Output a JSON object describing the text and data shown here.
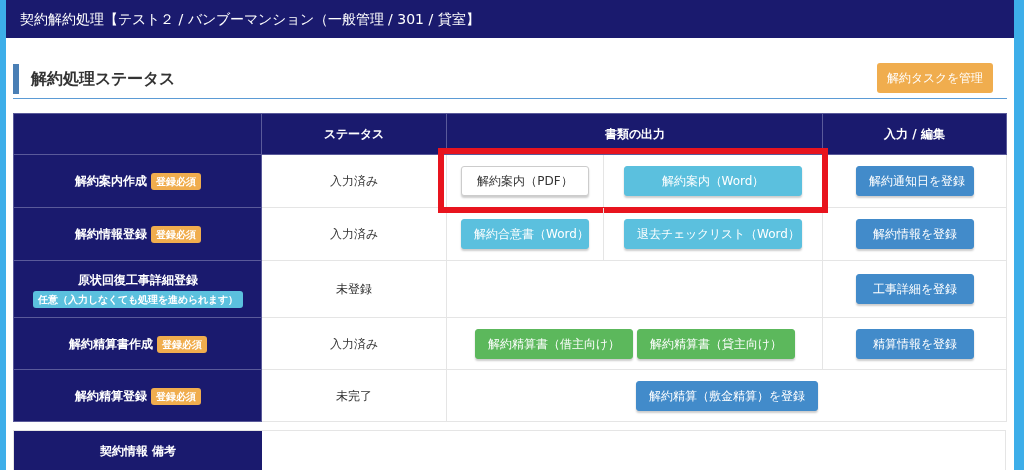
{
  "header": {
    "title": "契約解約処理【テスト２ / バンブーマンション（一般管理 / 301 / 貸室】"
  },
  "section": {
    "title": "解約処理ステータス",
    "action": {
      "label": "解約タスクを管理"
    }
  },
  "table": {
    "columns": [
      "",
      "ステータス",
      "書類の出力",
      "入力 / 編集"
    ],
    "rows": [
      {
        "name": "解約案内作成",
        "badge": {
          "kind": "required",
          "label": "登録必須"
        },
        "status": "入力済み",
        "docs_highlighted": true,
        "kind": "split",
        "docs": [
          {
            "kind": "default",
            "label": "解約案内（PDF）"
          },
          {
            "kind": "info",
            "label": "解約案内（Word）"
          }
        ],
        "edit": {
          "kind": "primary",
          "label": "解約通知日を登録"
        }
      },
      {
        "name": "解約情報登録",
        "badge": {
          "kind": "required",
          "label": "登録必須"
        },
        "status": "入力済み",
        "docs_highlighted": false,
        "kind": "split",
        "docs": [
          {
            "kind": "info",
            "label": "解約合意書（Word）"
          },
          {
            "kind": "info",
            "label": "退去チェックリスト（Word）"
          }
        ],
        "edit": {
          "kind": "primary",
          "label": "解約情報を登録"
        }
      },
      {
        "name": "原状回復工事詳細登録",
        "badge": {
          "kind": "optional",
          "label": "任意（入力しなくても処理を進められます）"
        },
        "status": "未登録",
        "docs_highlighted": false,
        "kind": "none",
        "docs": [],
        "edit": {
          "kind": "primary",
          "label": "工事詳細を登録"
        }
      },
      {
        "name": "解約精算書作成",
        "badge": {
          "kind": "required",
          "label": "登録必須"
        },
        "status": "入力済み",
        "docs_highlighted": false,
        "kind": "center",
        "docs": [
          {
            "kind": "success",
            "label": "解約精算書（借主向け）"
          },
          {
            "kind": "success",
            "label": "解約精算書（貸主向け）"
          }
        ],
        "edit": {
          "kind": "primary",
          "label": "精算情報を登録"
        }
      },
      {
        "name": "解約精算登録",
        "badge": {
          "kind": "required",
          "label": "登録必須"
        },
        "status": "未完了",
        "kind": "merged",
        "docs": [
          {
            "kind": "primary",
            "label": "解約精算（敷金精算）を登録"
          }
        ]
      }
    ]
  },
  "notes": {
    "label": "契約情報 備考"
  }
}
